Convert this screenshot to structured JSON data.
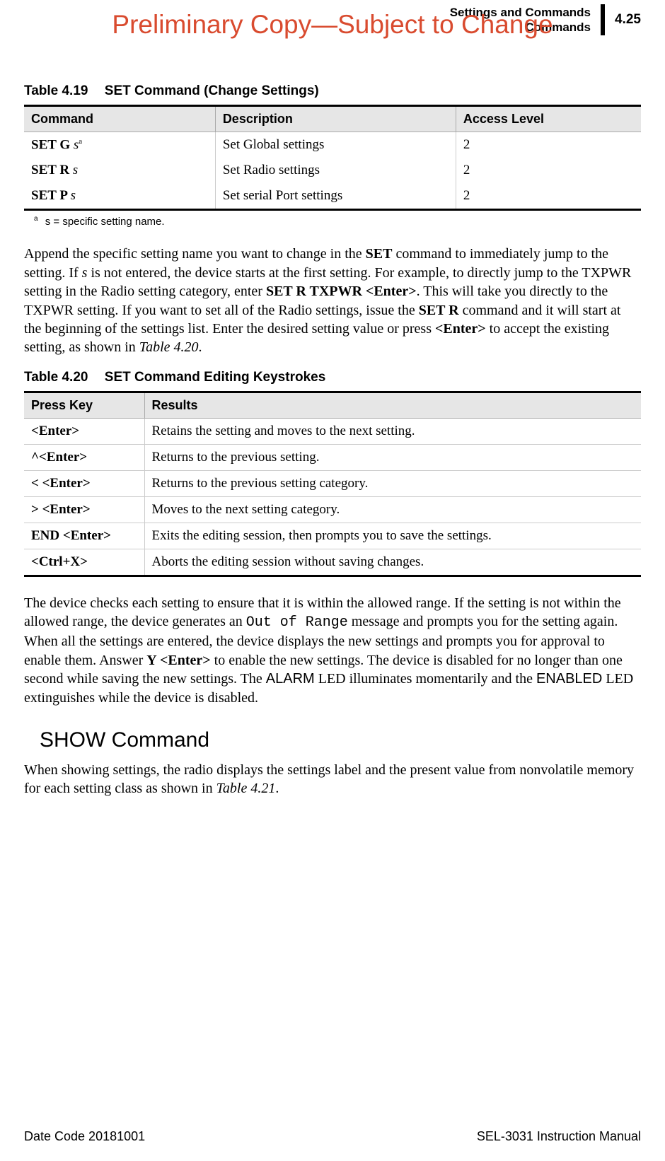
{
  "watermark": "Preliminary Copy—Subject to Change",
  "header": {
    "line1": "Settings and Commands",
    "line2": "Commands",
    "pagenum": "4.25"
  },
  "table419": {
    "num": "Table 4.19",
    "title": "SET Command (Change Settings)",
    "headers": [
      "Command",
      "Description",
      "Access Level"
    ],
    "rows": [
      {
        "cmd_pre": "SET G ",
        "cmd_it": "s",
        "cmd_sup": "a",
        "desc": "Set Global settings",
        "level": "2"
      },
      {
        "cmd_pre": "SET R ",
        "cmd_it": "s",
        "cmd_sup": "",
        "desc": "Set Radio settings",
        "level": "2"
      },
      {
        "cmd_pre": "SET P ",
        "cmd_it": "s",
        "cmd_sup": "",
        "desc": "Set serial Port settings",
        "level": "2"
      }
    ],
    "footnote_a": "a",
    "footnote_text": "s = specific setting name."
  },
  "para1": {
    "t1": "Append the specific setting name you want to change in the ",
    "b1": "SET",
    "t2": " command to immediately jump to the setting. If ",
    "i1": "s",
    "t3": " is not entered, the device starts at the first setting. For example, to directly jump to the TXPWR setting in the Radio setting category, enter ",
    "b2": "SET R TXPWR <Enter>",
    "t4": ". This will take you directly to the TXPWR setting. If you want to set all of the Radio settings, issue the ",
    "b3": "SET R",
    "t5": " command and it will start at the beginning of the settings list. Enter the desired setting value or press ",
    "b4": "<Enter>",
    "t6": " to accept the existing setting, as shown in ",
    "i2": "Table 4.20",
    "t7": "."
  },
  "table420": {
    "num": "Table 4.20",
    "title": "SET Command Editing Keystrokes",
    "headers": [
      "Press Key",
      "Results"
    ],
    "rows": [
      {
        "key": "<Enter>",
        "result": "Retains the setting and moves to the next setting."
      },
      {
        "key": "^<Enter>",
        "result": "Returns to the previous setting."
      },
      {
        "key": "< <Enter>",
        "result": "Returns to the previous setting category."
      },
      {
        "key": "> <Enter>",
        "result": "Moves to the next setting category."
      },
      {
        "key": "END <Enter>",
        "result": "Exits the editing session, then prompts you to save the settings."
      },
      {
        "key": "<Ctrl+X>",
        "result": "Aborts the editing session without saving changes."
      }
    ]
  },
  "para2": {
    "t1": "The device checks each setting to ensure that it is within the allowed range. If the setting is not within the allowed range, the device generates an ",
    "m1": "Out of Range",
    "t2": " message and prompts you for the setting again. When all the settings are entered, the device displays the new settings and prompts you for approval to enable them. Answer ",
    "b1": "Y <Enter>",
    "t3": " to enable the new settings. The device is disabled for no longer than one second while saving the new settings. The ",
    "s1": "ALARM",
    "t4": " LED illuminates momentarily and the ",
    "s2": "ENABLED",
    "t5": " LED extinguishes while the device is disabled."
  },
  "show_heading": "SHOW Command",
  "para3": {
    "t1": "When showing settings, the radio displays the settings label and the present value from nonvolatile memory for each setting class as shown in ",
    "i1": "Table 4.21",
    "t2": "."
  },
  "footer": {
    "left": "Date Code 20181001",
    "right": "SEL-3031 Instruction Manual"
  }
}
